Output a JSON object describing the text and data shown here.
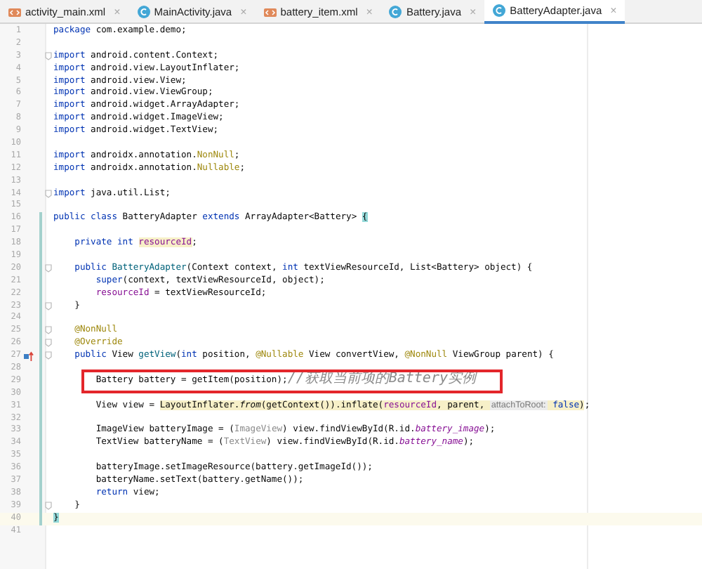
{
  "tabs": [
    {
      "label": "activity_main.xml",
      "kind": "xml",
      "selected": false
    },
    {
      "label": "MainActivity.java",
      "kind": "class",
      "selected": false
    },
    {
      "label": "battery_item.xml",
      "kind": "xml",
      "selected": false
    },
    {
      "label": "Battery.java",
      "kind": "class",
      "selected": false
    },
    {
      "label": "BatteryAdapter.java",
      "kind": "class",
      "selected": true
    }
  ],
  "close_glyph": "×",
  "lines": [
    {
      "n": "1",
      "tokens": [
        {
          "text": "package",
          "kind": "keyword"
        },
        {
          "text": " com.example.demo;",
          "kind": "plain"
        }
      ]
    },
    {
      "n": "2"
    },
    {
      "n": "3",
      "markers": [
        {
          "kind": "fold"
        }
      ],
      "tokens": [
        {
          "text": "import",
          "kind": "keyword"
        },
        {
          "text": " android.content.Context;",
          "kind": "plain"
        }
      ]
    },
    {
      "n": "4",
      "tokens": [
        {
          "text": "import",
          "kind": "keyword"
        },
        {
          "text": " android.view.LayoutInflater;",
          "kind": "plain"
        }
      ]
    },
    {
      "n": "5",
      "tokens": [
        {
          "text": "import",
          "kind": "keyword"
        },
        {
          "text": " android.view.View;",
          "kind": "plain"
        }
      ]
    },
    {
      "n": "6",
      "tokens": [
        {
          "text": "import",
          "kind": "keyword"
        },
        {
          "text": " android.view.ViewGroup;",
          "kind": "plain"
        }
      ]
    },
    {
      "n": "7",
      "tokens": [
        {
          "text": "import",
          "kind": "keyword"
        },
        {
          "text": " android.widget.ArrayAdapter;",
          "kind": "plain"
        }
      ]
    },
    {
      "n": "8",
      "tokens": [
        {
          "text": "import",
          "kind": "keyword"
        },
        {
          "text": " android.widget.ImageView;",
          "kind": "plain"
        }
      ]
    },
    {
      "n": "9",
      "tokens": [
        {
          "text": "import",
          "kind": "keyword"
        },
        {
          "text": " android.widget.TextView;",
          "kind": "plain"
        }
      ]
    },
    {
      "n": "10"
    },
    {
      "n": "11",
      "tokens": [
        {
          "text": "import",
          "kind": "keyword"
        },
        {
          "text": " androidx.annotation.",
          "kind": "plain"
        },
        {
          "text": "NonNull",
          "kind": "annotation"
        },
        {
          "text": ";",
          "kind": "plain"
        }
      ]
    },
    {
      "n": "12",
      "tokens": [
        {
          "text": "import",
          "kind": "keyword"
        },
        {
          "text": " androidx.annotation.",
          "kind": "plain"
        },
        {
          "text": "Nullable",
          "kind": "annotation"
        },
        {
          "text": ";",
          "kind": "plain"
        }
      ]
    },
    {
      "n": "13"
    },
    {
      "n": "14",
      "markers": [
        {
          "kind": "fold"
        }
      ],
      "tokens": [
        {
          "text": "import",
          "kind": "keyword"
        },
        {
          "text": " java.util.List;",
          "kind": "plain"
        }
      ]
    },
    {
      "n": "15"
    },
    {
      "n": "16",
      "markers": [
        {
          "kind": "changed"
        }
      ],
      "tokens": [
        {
          "text": "public class",
          "kind": "keyword"
        },
        {
          "text": " BatteryAdapter ",
          "kind": "plain"
        },
        {
          "text": "extends",
          "kind": "keyword"
        },
        {
          "text": " ArrayAdapter<Battery> ",
          "kind": "plain"
        },
        {
          "text": "{",
          "kind": "brace-match"
        }
      ]
    },
    {
      "n": "17",
      "markers": [
        {
          "kind": "changed"
        }
      ]
    },
    {
      "n": "18",
      "markers": [
        {
          "kind": "changed"
        }
      ],
      "tokens": [
        {
          "text": "    private int ",
          "kind": "keyword"
        },
        {
          "kind": "highlight",
          "tokens": [
            {
              "text": "resourceId",
              "kind": "field"
            }
          ]
        },
        {
          "text": ";",
          "kind": "plain"
        }
      ]
    },
    {
      "n": "19",
      "markers": [
        {
          "kind": "changed"
        }
      ]
    },
    {
      "n": "20",
      "markers": [
        {
          "kind": "changed"
        },
        {
          "kind": "fold"
        }
      ],
      "tokens": [
        {
          "text": "    public ",
          "kind": "keyword"
        },
        {
          "text": "BatteryAdapter",
          "kind": "method"
        },
        {
          "text": "(Context context, ",
          "kind": "plain"
        },
        {
          "text": "int",
          "kind": "keyword"
        },
        {
          "text": " textViewResourceId, List<Battery> object) {",
          "kind": "plain"
        }
      ]
    },
    {
      "n": "21",
      "markers": [
        {
          "kind": "changed"
        }
      ],
      "tokens": [
        {
          "text": "        super",
          "kind": "keyword"
        },
        {
          "text": "(context, textViewResourceId, object);",
          "kind": "plain"
        }
      ]
    },
    {
      "n": "22",
      "markers": [
        {
          "kind": "changed"
        }
      ],
      "tokens": [
        {
          "text": "        resourceId",
          "kind": "field"
        },
        {
          "text": " = textViewResourceId;",
          "kind": "plain"
        }
      ]
    },
    {
      "n": "23",
      "markers": [
        {
          "kind": "changed"
        },
        {
          "kind": "fold"
        }
      ],
      "tokens": [
        {
          "text": "    }",
          "kind": "plain"
        }
      ]
    },
    {
      "n": "24",
      "markers": [
        {
          "kind": "changed"
        }
      ]
    },
    {
      "n": "25",
      "markers": [
        {
          "kind": "changed"
        },
        {
          "kind": "fold"
        }
      ],
      "tokens": [
        {
          "text": "    @NonNull",
          "kind": "annotation"
        }
      ]
    },
    {
      "n": "26",
      "markers": [
        {
          "kind": "changed"
        },
        {
          "kind": "fold"
        }
      ],
      "tokens": [
        {
          "text": "    @Override",
          "kind": "annotation"
        }
      ]
    },
    {
      "n": "27",
      "markers": [
        {
          "kind": "changed"
        },
        {
          "kind": "override"
        },
        {
          "kind": "fold"
        }
      ],
      "tokens": [
        {
          "text": "    public",
          "kind": "keyword"
        },
        {
          "text": " View ",
          "kind": "plain"
        },
        {
          "text": "getView",
          "kind": "method"
        },
        {
          "text": "(",
          "kind": "plain"
        },
        {
          "text": "int",
          "kind": "keyword"
        },
        {
          "text": " position, ",
          "kind": "plain"
        },
        {
          "text": "@Nullable",
          "kind": "annotation"
        },
        {
          "text": " View convertView, ",
          "kind": "plain"
        },
        {
          "text": "@NonNull",
          "kind": "annotation"
        },
        {
          "text": " ViewGroup parent) {",
          "kind": "plain"
        }
      ]
    },
    {
      "n": "28",
      "markers": [
        {
          "kind": "changed"
        }
      ]
    },
    {
      "n": "29",
      "markers": [
        {
          "kind": "changed"
        },
        {
          "kind": "boxed"
        }
      ],
      "tokens": [
        {
          "text": "        Battery battery = getItem(position);",
          "kind": "plain"
        },
        {
          "text": "//获取当前项的Battery实例",
          "kind": "comment"
        }
      ]
    },
    {
      "n": "30",
      "markers": [
        {
          "kind": "changed"
        }
      ]
    },
    {
      "n": "31",
      "markers": [
        {
          "kind": "changed"
        }
      ],
      "tokens": [
        {
          "text": "        View view = ",
          "kind": "plain"
        },
        {
          "kind": "highlight",
          "tokens": [
            {
              "text": "LayoutInflater.",
              "kind": "plain"
            },
            {
              "text": "from",
              "kind": "static"
            },
            {
              "text": "(getContext()).inflate(",
              "kind": "plain"
            },
            {
              "text": "resourceId",
              "kind": "field"
            },
            {
              "text": ", parent, ",
              "kind": "plain"
            },
            {
              "text": "attachToRoot:",
              "kind": "hint"
            },
            {
              "text": " false",
              "kind": "keyword"
            },
            {
              "text": ")",
              "kind": "plain"
            }
          ]
        },
        {
          "text": ";",
          "kind": "plain"
        }
      ]
    },
    {
      "n": "32",
      "markers": [
        {
          "kind": "changed"
        }
      ]
    },
    {
      "n": "33",
      "markers": [
        {
          "kind": "changed"
        }
      ],
      "tokens": [
        {
          "text": "        ImageView batteryImage = (",
          "kind": "plain"
        },
        {
          "text": "ImageView",
          "kind": "redundant"
        },
        {
          "text": ") view.findViewById(R.id.",
          "kind": "plain"
        },
        {
          "text": "battery_image",
          "kind": "static-field"
        },
        {
          "text": ");",
          "kind": "plain"
        }
      ]
    },
    {
      "n": "34",
      "markers": [
        {
          "kind": "changed"
        }
      ],
      "tokens": [
        {
          "text": "        TextView batteryName = (",
          "kind": "plain"
        },
        {
          "text": "TextView",
          "kind": "redundant"
        },
        {
          "text": ") view.findViewById(R.id.",
          "kind": "plain"
        },
        {
          "text": "battery_name",
          "kind": "static-field"
        },
        {
          "text": ");",
          "kind": "plain"
        }
      ]
    },
    {
      "n": "35",
      "markers": [
        {
          "kind": "changed"
        }
      ]
    },
    {
      "n": "36",
      "markers": [
        {
          "kind": "changed"
        }
      ],
      "tokens": [
        {
          "text": "        batteryImage.setImageResource(battery.getImageId());",
          "kind": "plain"
        }
      ]
    },
    {
      "n": "37",
      "markers": [
        {
          "kind": "changed"
        }
      ],
      "tokens": [
        {
          "text": "        batteryName.setText(battery.getName());",
          "kind": "plain"
        }
      ]
    },
    {
      "n": "38",
      "markers": [
        {
          "kind": "changed"
        }
      ],
      "tokens": [
        {
          "text": "        return",
          "kind": "keyword"
        },
        {
          "text": " view;",
          "kind": "plain"
        }
      ]
    },
    {
      "n": "39",
      "markers": [
        {
          "kind": "changed"
        },
        {
          "kind": "fold"
        }
      ],
      "tokens": [
        {
          "text": "    }",
          "kind": "plain"
        }
      ]
    },
    {
      "n": "40",
      "markers": [
        {
          "kind": "changed"
        },
        {
          "kind": "current"
        }
      ],
      "tokens": [
        {
          "text": "}",
          "kind": "brace-match"
        }
      ]
    },
    {
      "n": "41"
    }
  ]
}
